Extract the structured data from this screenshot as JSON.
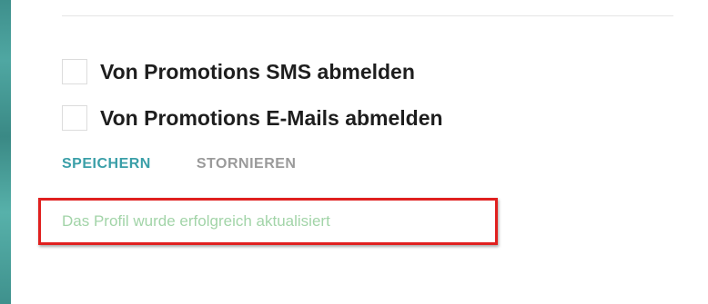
{
  "preferences": {
    "sms_unsubscribe_label": "Von Promotions SMS abmelden",
    "sms_unsubscribe_checked": false,
    "email_unsubscribe_label": "Von Promotions E-Mails abmelden",
    "email_unsubscribe_checked": false
  },
  "actions": {
    "save_label": "SPEICHERN",
    "cancel_label": "STORNIEREN"
  },
  "status": {
    "success_message": "Das Profil wurde erfolgreich aktualisiert"
  },
  "colors": {
    "accent": "#3a9fa8",
    "success_text": "#a2d4a8",
    "highlight_border": "#e0201f",
    "cancel_text": "#9a9a9a"
  }
}
